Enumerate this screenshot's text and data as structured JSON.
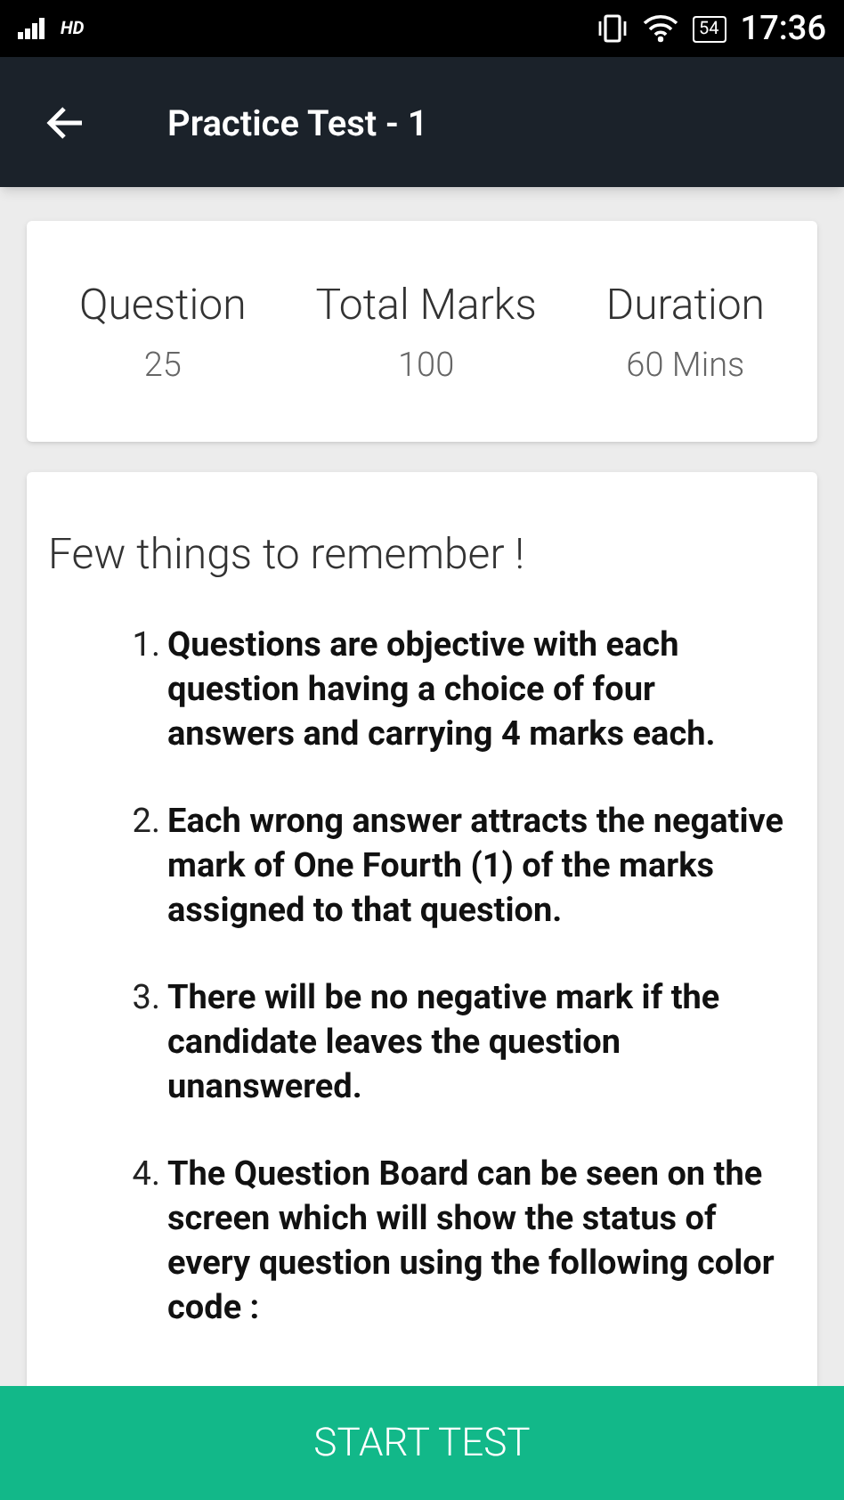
{
  "status_bar": {
    "network": "HD",
    "battery": "54",
    "time": "17:36"
  },
  "app_bar": {
    "title": "Practice Test - 1"
  },
  "summary": [
    {
      "label": "Question",
      "value": "25"
    },
    {
      "label": "Total Marks",
      "value": "100"
    },
    {
      "label": "Duration",
      "value": "60 Mins"
    }
  ],
  "instructions": {
    "heading": "Few things to remember !",
    "items": [
      {
        "number": "1.",
        "text": "Questions are objective with each question having a choice of four answers and carrying 4 marks each."
      },
      {
        "number": "2.",
        "text": "Each wrong answer attracts the negative mark of One Fourth (1) of the marks assigned to that question."
      },
      {
        "number": "3.",
        "text": "There will be no negative mark if the candidate leaves the question unanswered."
      },
      {
        "number": "4.",
        "text": "The Question Board can be seen on the screen which will show the status of every question using the following color code :"
      }
    ]
  },
  "start_button": {
    "label": "START TEST"
  }
}
